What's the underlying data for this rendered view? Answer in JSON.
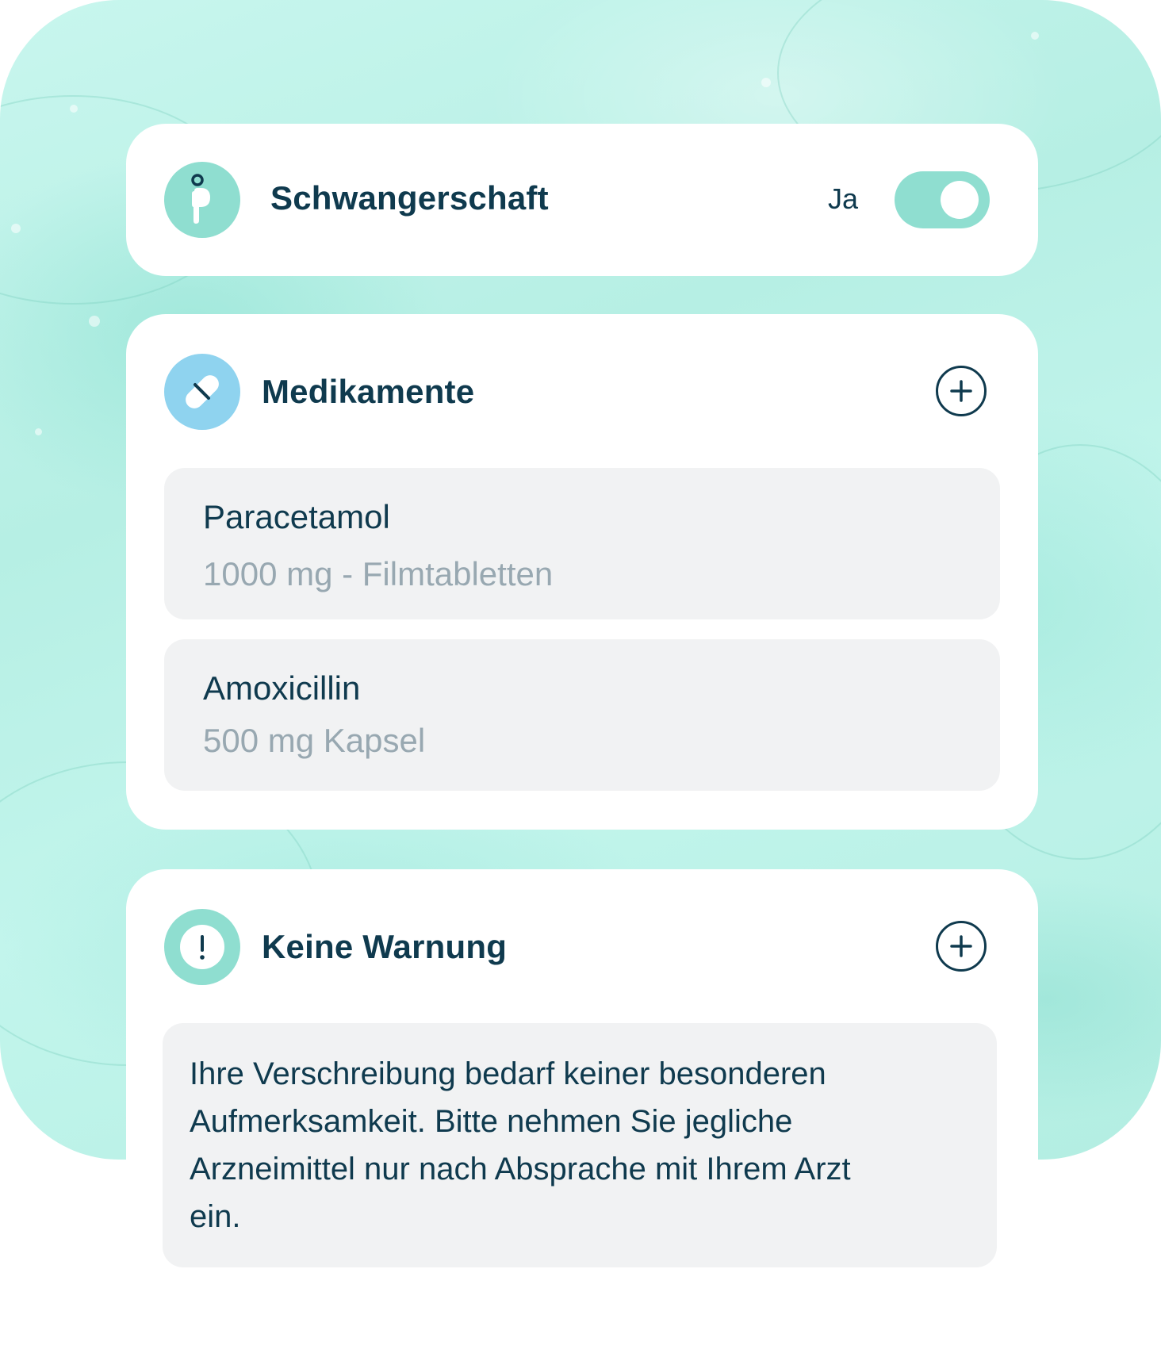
{
  "colors": {
    "accent_mint": "#8fded0",
    "accent_blue": "#8fd3ef",
    "text_primary": "#0f3a4e",
    "text_secondary": "#98a8b1",
    "item_background": "#f1f2f3"
  },
  "pregnancy": {
    "icon": "pregnancy-icon",
    "title": "Schwangerschaft",
    "toggle_label": "Ja",
    "toggle_on": true
  },
  "medications": {
    "icon": "pill-icon",
    "title": "Medikamente",
    "add_icon": "plus-circle-icon",
    "items": [
      {
        "name": "Paracetamol",
        "detail": "1000 mg - Filmtabletten"
      },
      {
        "name": "Amoxicillin",
        "detail": "500 mg Kapsel"
      }
    ]
  },
  "warning": {
    "icon": "exclamation-icon",
    "title": "Keine Warnung",
    "add_icon": "plus-circle-icon",
    "message": "Ihre Verschreibung bedarf keiner besonderen Aufmerksamkeit. Bitte nehmen Sie jegliche Arzneimittel nur nach Absprache mit Ihrem Arzt ein."
  }
}
